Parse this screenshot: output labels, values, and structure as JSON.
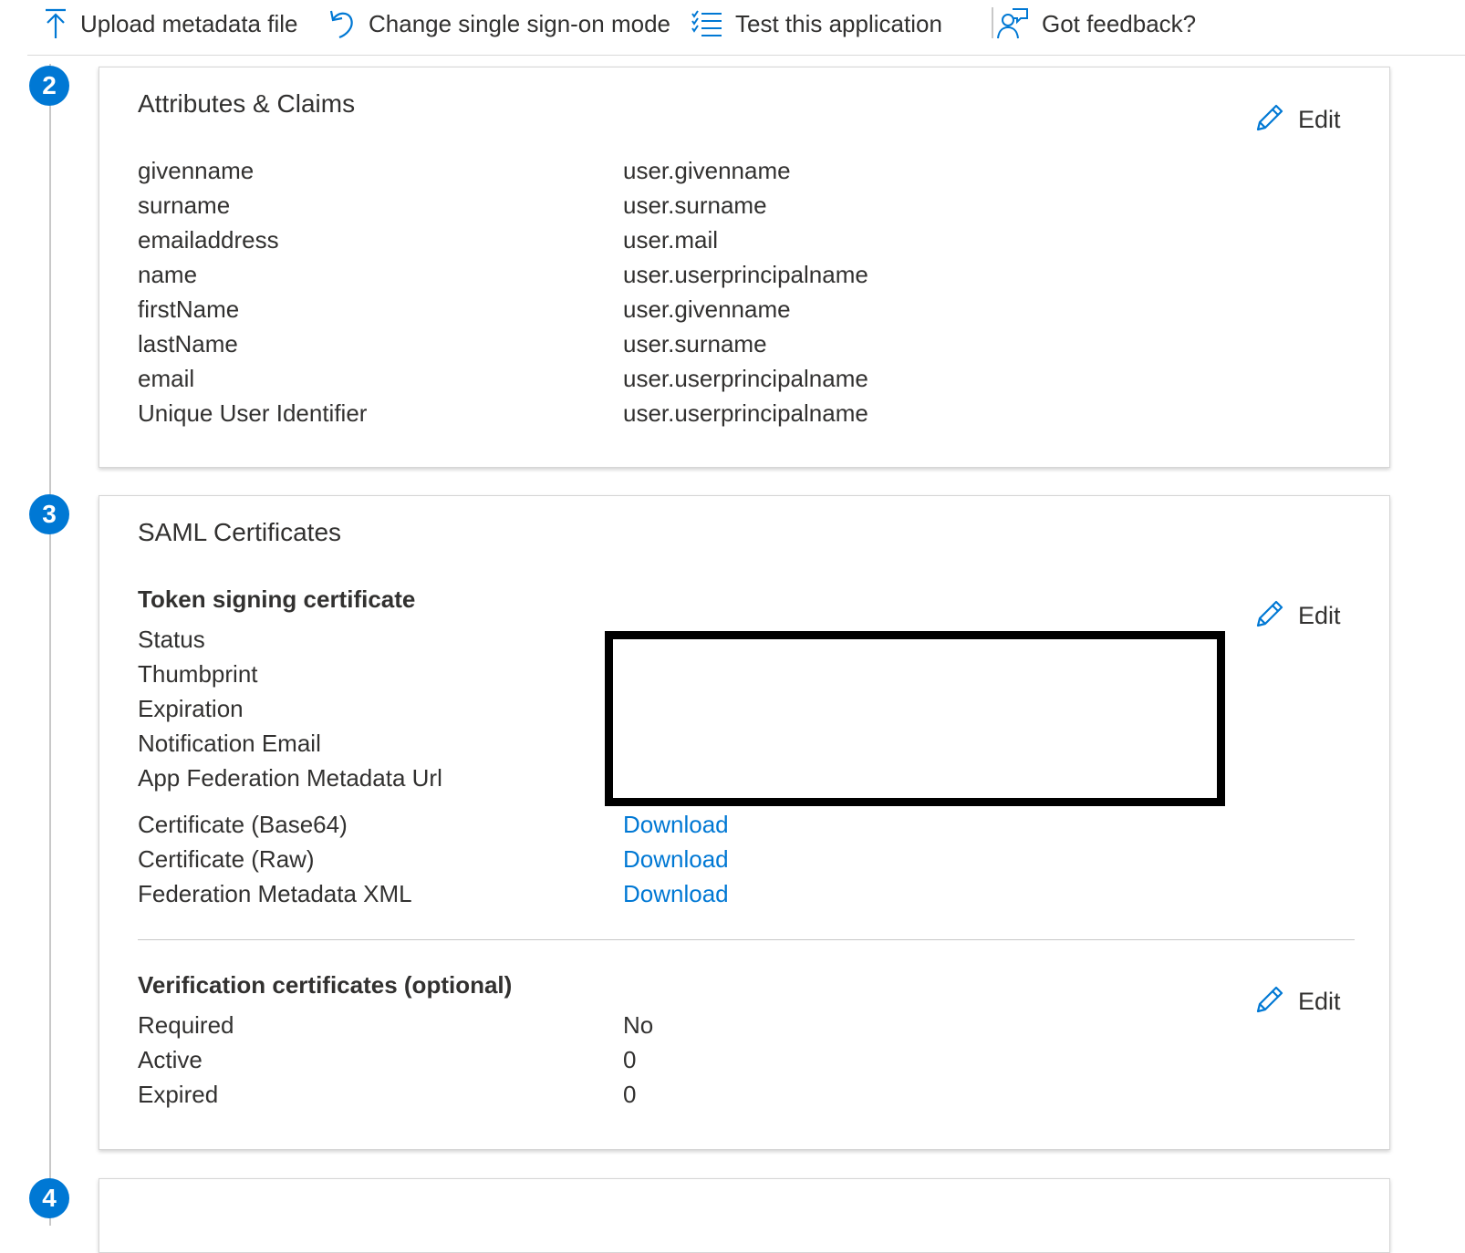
{
  "toolbar": {
    "upload_label": "Upload metadata file",
    "change_sso_label": "Change single sign-on mode",
    "test_label": "Test this application",
    "feedback_label": "Got feedback?"
  },
  "steps": {
    "attributes_number": "2",
    "saml_number": "3",
    "next_number": "4"
  },
  "attributes": {
    "title": "Attributes & Claims",
    "edit_label": "Edit",
    "rows": [
      {
        "key": "givenname",
        "value": "user.givenname"
      },
      {
        "key": "surname",
        "value": "user.surname"
      },
      {
        "key": "emailaddress",
        "value": "user.mail"
      },
      {
        "key": "name",
        "value": "user.userprincipalname"
      },
      {
        "key": "firstName",
        "value": "user.givenname"
      },
      {
        "key": "lastName",
        "value": "user.surname"
      },
      {
        "key": "email",
        "value": "user.userprincipalname"
      },
      {
        "key": "Unique User Identifier",
        "value": "user.userprincipalname"
      }
    ]
  },
  "saml": {
    "title": "SAML Certificates",
    "token_signing": {
      "heading": "Token signing certificate",
      "edit_label": "Edit",
      "fields": [
        "Status",
        "Thumbprint",
        "Expiration",
        "Notification Email",
        "App Federation Metadata Url"
      ],
      "downloads": [
        {
          "key": "Certificate (Base64)",
          "link": "Download"
        },
        {
          "key": "Certificate (Raw)",
          "link": "Download"
        },
        {
          "key": "Federation Metadata XML",
          "link": "Download"
        }
      ]
    },
    "verification": {
      "heading": "Verification certificates (optional)",
      "edit_label": "Edit",
      "rows": [
        {
          "key": "Required",
          "value": "No"
        },
        {
          "key": "Active",
          "value": "0"
        },
        {
          "key": "Expired",
          "value": "0"
        }
      ]
    }
  },
  "colors": {
    "accent": "#0078d4",
    "text": "#323130",
    "border": "#d6d6d6"
  },
  "icons": [
    "upload-icon",
    "undo-icon",
    "checklist-icon",
    "feedback-icon",
    "pencil-icon"
  ]
}
